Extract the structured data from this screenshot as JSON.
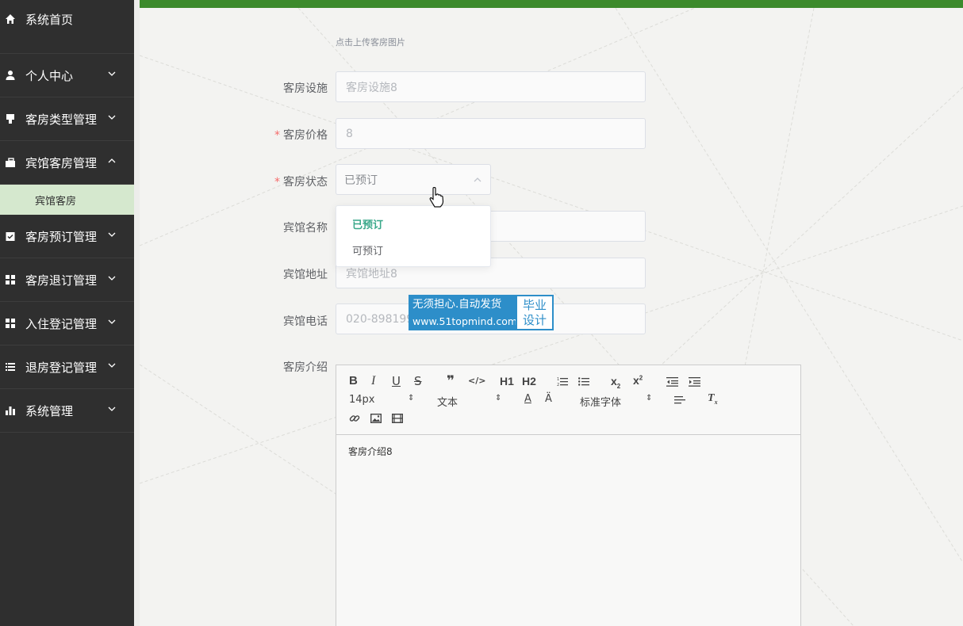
{
  "sidebar": {
    "items": [
      {
        "label": "系统首页",
        "icon": "home-icon"
      },
      {
        "label": "个人中心",
        "icon": "user-icon"
      },
      {
        "label": "客房类型管理",
        "icon": "bed-icon"
      },
      {
        "label": "宾馆客房管理",
        "icon": "briefcase-icon"
      },
      {
        "label": "客房预订管理",
        "icon": "clipboard-icon"
      },
      {
        "label": "客房退订管理",
        "icon": "grid-icon"
      },
      {
        "label": "入住登记管理",
        "icon": "grid-icon"
      },
      {
        "label": "退房登记管理",
        "icon": "list-icon"
      },
      {
        "label": "系统管理",
        "icon": "bar-chart-icon"
      }
    ],
    "sub_item": "宾馆客房"
  },
  "form": {
    "upload_hint": "点击上传客房图片",
    "facilities": {
      "label": "客房设施",
      "value": "客房设施8"
    },
    "price": {
      "label": "客房价格",
      "value": "8"
    },
    "status": {
      "label": "客房状态",
      "value": "已预订"
    },
    "status_options": [
      "已预订",
      "可预订"
    ],
    "hotel_name": {
      "label": "宾馆名称"
    },
    "hotel_address": {
      "label": "宾馆地址",
      "value": "宾馆地址8"
    },
    "hotel_phone": {
      "label": "宾馆电话",
      "value": "020-898199"
    },
    "intro": {
      "label": "客房介绍",
      "content": "客房介绍8"
    },
    "required_mark": "*"
  },
  "editor": {
    "font_size": "14px",
    "paragraph": "文本",
    "font_family": "标准字体",
    "headers": [
      "H1",
      "H2"
    ]
  },
  "watermark": {
    "line1": "无须担心.自动发货",
    "line2": "www.51topmind.com",
    "right1": "毕业",
    "right2": "设计"
  },
  "colors": {
    "topbar": "#3c8a2c",
    "sidebar_bg": "#2f2f2f",
    "sub_bg": "#d5e8ce",
    "selected_option": "#3aa88a",
    "required": "#f56c6c"
  }
}
